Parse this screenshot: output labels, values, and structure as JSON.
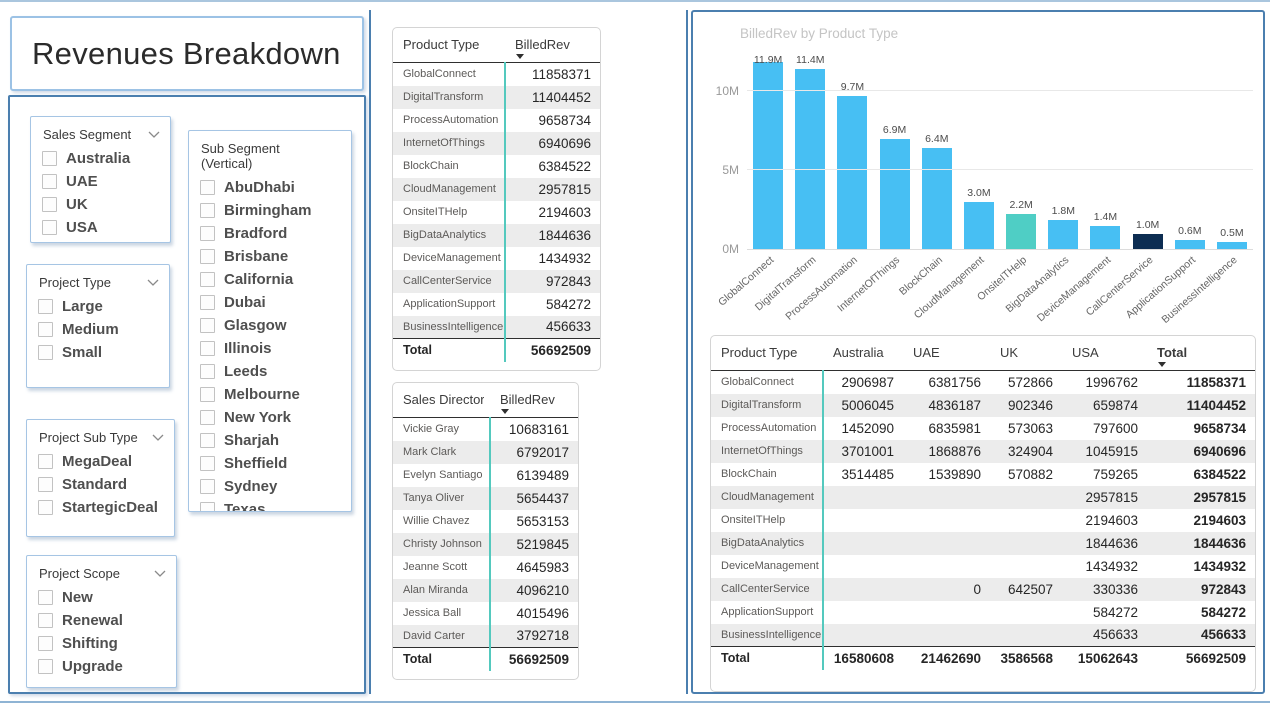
{
  "title": "Revenues Breakdown",
  "colors": {
    "panel_border": "#4b7faf",
    "light_border": "#9cc2e5",
    "teal_divider": "#54c9be",
    "alt_row": "#ececec",
    "bar_default": "#47bff3",
    "bar_teal": "#4fcec5",
    "bar_navy": "#0d2d52"
  },
  "filters": [
    {
      "label": "Sales Segment",
      "has_chevron": true,
      "items": [
        "Australia",
        "UAE",
        "UK",
        "USA"
      ]
    },
    {
      "label": "Project Type",
      "has_chevron": true,
      "items": [
        "Large",
        "Medium",
        "Small"
      ]
    },
    {
      "label": "Project Sub Type",
      "has_chevron": true,
      "items": [
        "MegaDeal",
        "Standard",
        "StartegicDeal"
      ]
    },
    {
      "label": "Project Scope",
      "has_chevron": true,
      "items": [
        "New",
        "Renewal",
        "Shifting",
        "Upgrade"
      ]
    },
    {
      "label": "Sub Segment (Vertical)",
      "has_chevron": false,
      "items": [
        "AbuDhabi",
        "Birmingham",
        "Bradford",
        "Brisbane",
        "California",
        "Dubai",
        "Glasgow",
        "Illinois",
        "Leeds",
        "Melbourne",
        "New York",
        "Sharjah",
        "Sheffield",
        "Sydney",
        "Texas"
      ]
    }
  ],
  "product_table": {
    "columns": [
      {
        "label": "Product Type",
        "sorted": false
      },
      {
        "label": "BilledRev",
        "sorted": true
      }
    ],
    "rows": [
      [
        "GlobalConnect",
        "11858371"
      ],
      [
        "DigitalTransform",
        "11404452"
      ],
      [
        "ProcessAutomation",
        "9658734"
      ],
      [
        "InternetOfThings",
        "6940696"
      ],
      [
        "BlockChain",
        "6384522"
      ],
      [
        "CloudManagement",
        "2957815"
      ],
      [
        "OnsiteITHelp",
        "2194603"
      ],
      [
        "BigDataAnalytics",
        "1844636"
      ],
      [
        "DeviceManagement",
        "1434932"
      ],
      [
        "CallCenterService",
        "972843"
      ],
      [
        "ApplicationSupport",
        "584272"
      ],
      [
        "BusinessIntelligence",
        "456633"
      ]
    ],
    "total": [
      "Total",
      "56692509"
    ]
  },
  "director_table": {
    "columns": [
      {
        "label": "Sales Director",
        "sorted": false
      },
      {
        "label": "BilledRev",
        "sorted": true
      }
    ],
    "rows": [
      [
        "Vickie Gray",
        "10683161"
      ],
      [
        "Mark Clark",
        "6792017"
      ],
      [
        "Evelyn Santiago",
        "6139489"
      ],
      [
        "Tanya Oliver",
        "5654437"
      ],
      [
        "Willie Chavez",
        "5653153"
      ],
      [
        "Christy Johnson",
        "5219845"
      ],
      [
        "Jeanne Scott",
        "4645983"
      ],
      [
        "Alan Miranda",
        "4096210"
      ],
      [
        "Jessica Ball",
        "4015496"
      ],
      [
        "David Carter",
        "3792718"
      ]
    ],
    "total": [
      "Total",
      "56692509"
    ]
  },
  "matrix": {
    "columns": [
      {
        "label": "Product Type",
        "sorted": false
      },
      {
        "label": "Australia",
        "sorted": false
      },
      {
        "label": "UAE",
        "sorted": false
      },
      {
        "label": "UK",
        "sorted": false
      },
      {
        "label": "USA",
        "sorted": false
      },
      {
        "label": "Total",
        "sorted": true
      }
    ],
    "rows": [
      [
        "GlobalConnect",
        "2906987",
        "6381756",
        "572866",
        "1996762",
        "11858371"
      ],
      [
        "DigitalTransform",
        "5006045",
        "4836187",
        "902346",
        "659874",
        "11404452"
      ],
      [
        "ProcessAutomation",
        "1452090",
        "6835981",
        "573063",
        "797600",
        "9658734"
      ],
      [
        "InternetOfThings",
        "3701001",
        "1868876",
        "324904",
        "1045915",
        "6940696"
      ],
      [
        "BlockChain",
        "3514485",
        "1539890",
        "570882",
        "759265",
        "6384522"
      ],
      [
        "CloudManagement",
        "",
        "",
        "",
        "2957815",
        "2957815"
      ],
      [
        "OnsiteITHelp",
        "",
        "",
        "",
        "2194603",
        "2194603"
      ],
      [
        "BigDataAnalytics",
        "",
        "",
        "",
        "1844636",
        "1844636"
      ],
      [
        "DeviceManagement",
        "",
        "",
        "",
        "1434932",
        "1434932"
      ],
      [
        "CallCenterService",
        "",
        "0",
        "642507",
        "330336",
        "972843"
      ],
      [
        "ApplicationSupport",
        "",
        "",
        "",
        "584272",
        "584272"
      ],
      [
        "BusinessIntelligence",
        "",
        "",
        "",
        "456633",
        "456633"
      ]
    ],
    "total": [
      "Total",
      "16580608",
      "21462690",
      "3586568",
      "15062643",
      "56692509"
    ]
  },
  "chart_data": {
    "type": "bar",
    "title": "BilledRev by Product Type",
    "categories": [
      "GlobalConnect",
      "DigitalTransform",
      "ProcessAutomation",
      "InternetOfThings",
      "BlockChain",
      "CloudManagement",
      "OnsiteITHelp",
      "BigDataAnalytics",
      "DeviceManagement",
      "CallCenterService",
      "ApplicationSupport",
      "BusinessIntelligence"
    ],
    "values": [
      11858371,
      11404452,
      9658734,
      6940696,
      6384522,
      2957815,
      2194603,
      1844636,
      1434932,
      972843,
      584272,
      456633
    ],
    "data_labels": [
      "11.9M",
      "11.4M",
      "9.7M",
      "6.9M",
      "6.4M",
      "3.0M",
      "2.2M",
      "1.8M",
      "1.4M",
      "1.0M",
      "0.6M",
      "0.5M"
    ],
    "xlabel": "",
    "ylabel": "",
    "ylim": [
      0,
      12500000
    ],
    "y_ticks": [
      {
        "label": "0M",
        "m": 0
      },
      {
        "label": "5M",
        "m": 5
      },
      {
        "label": "10M",
        "m": 10
      }
    ],
    "grid": true,
    "legend": "none",
    "bar_color": "#47bff3",
    "highlights": {
      "OnsiteITHelp": "#4fcec5",
      "CallCenterService": "#0d2d52"
    }
  }
}
